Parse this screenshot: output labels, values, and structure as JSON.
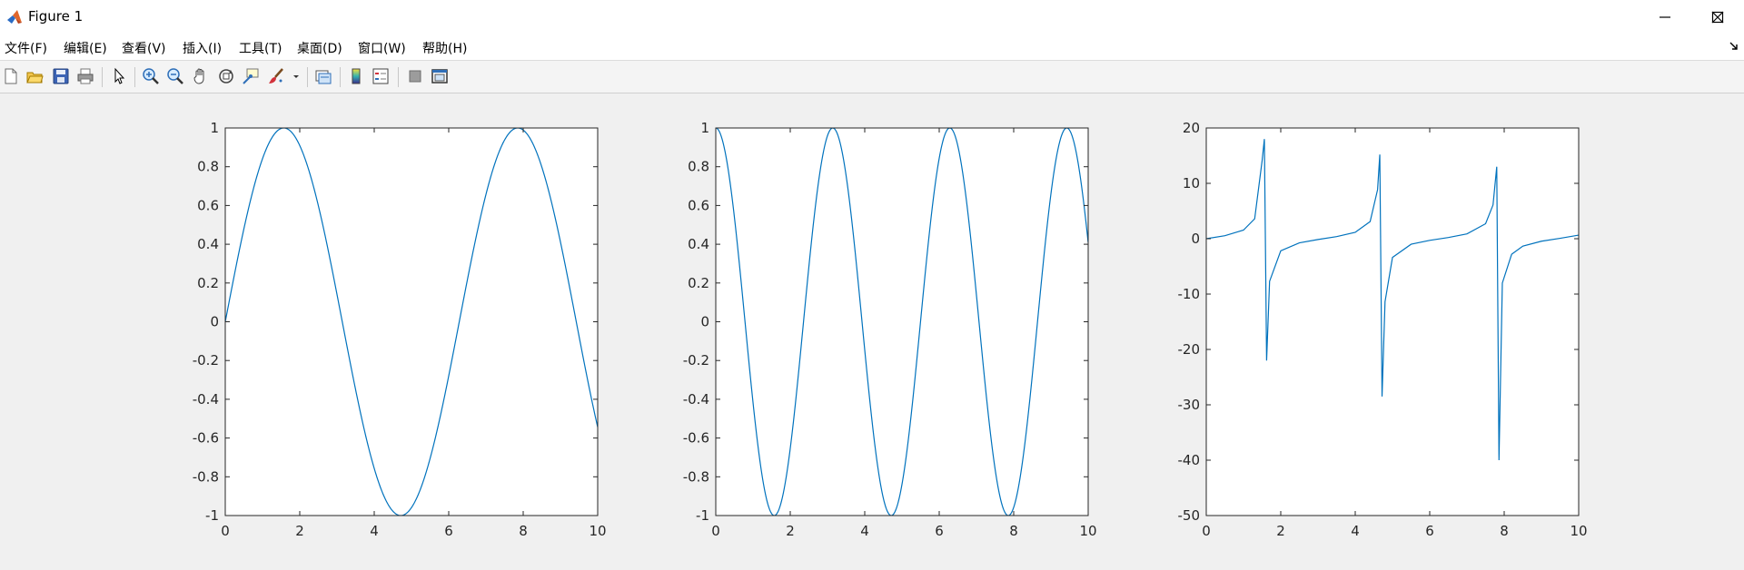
{
  "window": {
    "title": "Figure 1",
    "controls": [
      "minimize",
      "maximize",
      "close"
    ]
  },
  "menubar": {
    "items": [
      "文件(F)",
      "编辑(E)",
      "查看(V)",
      "插入(I)",
      "工具(T)",
      "桌面(D)",
      "窗口(W)",
      "帮助(H)"
    ]
  },
  "toolbar": {
    "icons": [
      "new-figure-icon",
      "open-file-icon",
      "save-icon",
      "print-icon",
      "pointer-icon",
      "zoom-in-icon",
      "zoom-out-icon",
      "pan-hand-icon",
      "rotate-3d-icon",
      "data-cursor-icon",
      "brush-icon",
      "brush-dropdown-icon",
      "link-plot-icon",
      "insert-colorbar-icon",
      "insert-legend-icon",
      "hide-plot-tools-icon",
      "show-plot-tools-icon"
    ]
  },
  "colors": {
    "line": "#0072bd",
    "axes": "#262626",
    "figure_bg": "#f0f0f0",
    "axes_bg": "#ffffff"
  },
  "chart_data": [
    {
      "type": "line",
      "title": "",
      "xlabel": "",
      "ylabel": "",
      "function": "sin(x)",
      "xlim": [
        0,
        10
      ],
      "ylim": [
        -1,
        1
      ],
      "xticks": [
        0,
        2,
        4,
        6,
        8,
        10
      ],
      "yticks": [
        -1,
        -0.8,
        -0.6,
        -0.4,
        -0.2,
        0,
        0.2,
        0.4,
        0.6,
        0.8,
        1
      ],
      "series": [
        {
          "x": [
            0,
            0.5,
            1.0,
            1.5,
            2.0,
            2.5,
            3.0,
            3.5,
            4.0,
            4.5,
            5.0,
            5.5,
            6.0,
            6.5,
            7.0,
            7.5,
            8.0,
            8.5,
            9.0,
            9.5,
            10.0
          ],
          "y": [
            0,
            0.479,
            0.841,
            0.997,
            0.909,
            0.598,
            0.141,
            -0.351,
            -0.757,
            -0.978,
            -0.959,
            -0.706,
            -0.279,
            0.215,
            0.657,
            0.938,
            0.989,
            0.798,
            0.412,
            -0.075,
            -0.544
          ]
        }
      ]
    },
    {
      "type": "line",
      "title": "",
      "xlabel": "",
      "ylabel": "",
      "function": "cos(2x)",
      "xlim": [
        0,
        10
      ],
      "ylim": [
        -1,
        1
      ],
      "xticks": [
        0,
        2,
        4,
        6,
        8,
        10
      ],
      "yticks": [
        -1,
        -0.8,
        -0.6,
        -0.4,
        -0.2,
        0,
        0.2,
        0.4,
        0.6,
        0.8,
        1
      ],
      "series": [
        {
          "x": [
            0,
            0.5,
            1.0,
            1.5,
            2.0,
            2.5,
            3.0,
            3.5,
            4.0,
            4.5,
            5.0,
            5.5,
            6.0,
            6.5,
            7.0,
            7.5,
            8.0,
            8.5,
            9.0,
            9.5,
            10.0
          ],
          "y": [
            1,
            0.54,
            -0.416,
            -0.99,
            -0.654,
            0.284,
            0.96,
            0.754,
            -0.146,
            -0.911,
            -0.839,
            0.004,
            0.844,
            0.907,
            0.137,
            -0.76,
            -0.958,
            -0.275,
            0.66,
            0.989,
            0.408
          ]
        }
      ]
    },
    {
      "type": "line",
      "title": "",
      "xlabel": "",
      "ylabel": "",
      "function": "tan(x)",
      "xlim": [
        0,
        10
      ],
      "ylim": [
        -50,
        20
      ],
      "xticks": [
        0,
        2,
        4,
        6,
        8,
        10
      ],
      "yticks": [
        -50,
        -40,
        -30,
        -20,
        -10,
        0,
        10,
        20
      ],
      "series": [
        {
          "x": [
            0,
            0.5,
            1.0,
            1.3,
            1.5,
            1.56,
            1.62,
            1.7,
            2.0,
            2.5,
            3.0,
            3.5,
            4.0,
            4.4,
            4.6,
            4.66,
            4.72,
            4.8,
            5.0,
            5.5,
            6.0,
            6.5,
            7.0,
            7.5,
            7.7,
            7.8,
            7.86,
            7.95,
            8.2,
            8.5,
            9.0,
            9.5,
            10.0
          ],
          "y": [
            0,
            0.546,
            1.557,
            3.602,
            14.101,
            18.0,
            -22.0,
            -7.697,
            -2.185,
            -0.747,
            -0.143,
            0.375,
            1.158,
            3.096,
            8.86,
            15.2,
            -28.5,
            -11.385,
            -3.381,
            -0.996,
            -0.291,
            0.22,
            0.871,
            2.706,
            6.1,
            13.0,
            -40.0,
            -8.0,
            -2.8,
            -1.339,
            -0.452,
            0.076,
            0.648
          ]
        }
      ]
    }
  ]
}
